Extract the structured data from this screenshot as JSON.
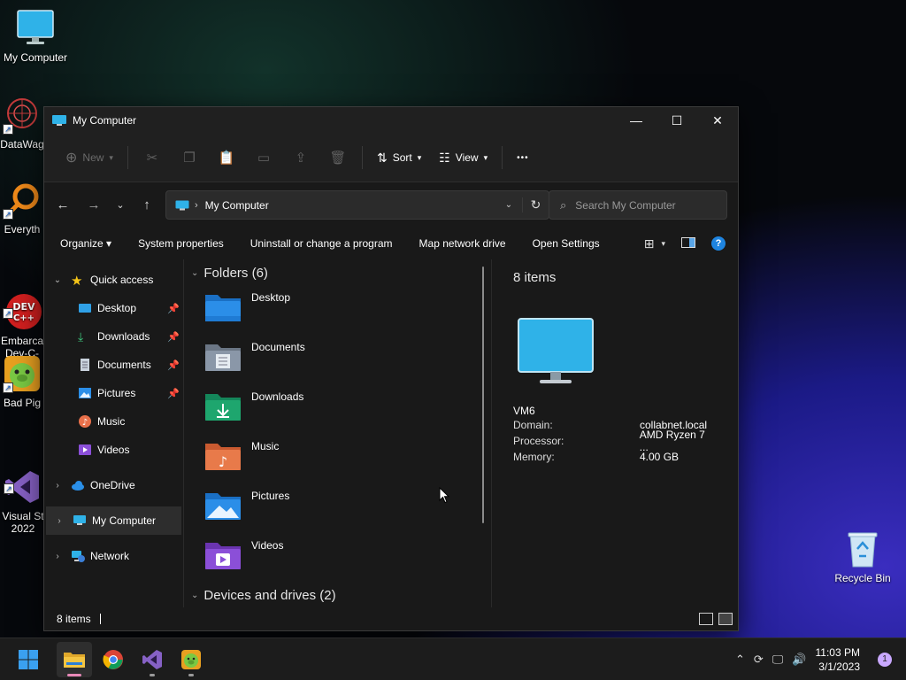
{
  "desktop": {
    "icons": [
      {
        "label": "My Computer",
        "icon": "monitor-icon"
      },
      {
        "label": "DataWag",
        "icon": "datawag-icon"
      },
      {
        "label": "Everyth",
        "icon": "search-magnifier-icon"
      },
      {
        "label": "Embarca\nDev-C-",
        "icon": "devcpp-icon"
      },
      {
        "label": "Bad Pig",
        "icon": "bad-piggies-icon"
      },
      {
        "label": "Visual St\n2022",
        "icon": "visual-studio-icon"
      },
      {
        "label": "Recycle Bin",
        "icon": "recycle-bin-icon"
      }
    ]
  },
  "window": {
    "title": "My Computer",
    "controls": {
      "minimize": "—",
      "maximize": "☐",
      "close": "✕"
    }
  },
  "toolbar": {
    "new_label": "New",
    "sort_label": "Sort",
    "view_label": "View",
    "more_label": "•••"
  },
  "address": {
    "crumb": "My Computer",
    "search_placeholder": "Search My Computer"
  },
  "commandbar": {
    "items": [
      "Organize",
      "System properties",
      "Uninstall or change a program",
      "Map network drive",
      "Open Settings"
    ],
    "organize_label": "Organize ▾",
    "help_label": "?"
  },
  "navpane": {
    "quick_access": "Quick access",
    "children": [
      {
        "label": "Desktop",
        "icon": "desktop-icon",
        "pinned": true
      },
      {
        "label": "Downloads",
        "icon": "download-icon",
        "pinned": true
      },
      {
        "label": "Documents",
        "icon": "document-icon",
        "pinned": true
      },
      {
        "label": "Pictures",
        "icon": "pictures-icon",
        "pinned": true
      },
      {
        "label": "Music",
        "icon": "music-icon",
        "pinned": false
      },
      {
        "label": "Videos",
        "icon": "videos-icon",
        "pinned": false
      }
    ],
    "onedrive": "OneDrive",
    "my_computer": "My Computer",
    "network": "Network"
  },
  "content": {
    "folders_header": "Folders (6)",
    "folders": [
      {
        "name": "Desktop",
        "color": "#2b8ee8"
      },
      {
        "name": "Documents",
        "color": "#8a97a8"
      },
      {
        "name": "Downloads",
        "color": "#1ea66e"
      },
      {
        "name": "Music",
        "color": "#e87a4a"
      },
      {
        "name": "Pictures",
        "color": "#2b8ee8"
      },
      {
        "name": "Videos",
        "color": "#8b4fd8"
      }
    ],
    "devices_header": "Devices and drives (2)"
  },
  "details": {
    "count": "8 items",
    "name": "VM6",
    "props": [
      {
        "key": "Domain:",
        "value": "collabnet.local"
      },
      {
        "key": "Processor:",
        "value": "AMD Ryzen 7 ..."
      },
      {
        "key": "Memory:",
        "value": "4.00 GB"
      }
    ]
  },
  "status": {
    "count": "8 items"
  },
  "taskbar": {
    "apps": [
      "start-icon",
      "file-explorer-icon",
      "chrome-icon",
      "visual-studio-icon",
      "bad-piggies-icon"
    ],
    "time": "11:03 PM",
    "date": "3/1/2023",
    "notifications": "1"
  }
}
